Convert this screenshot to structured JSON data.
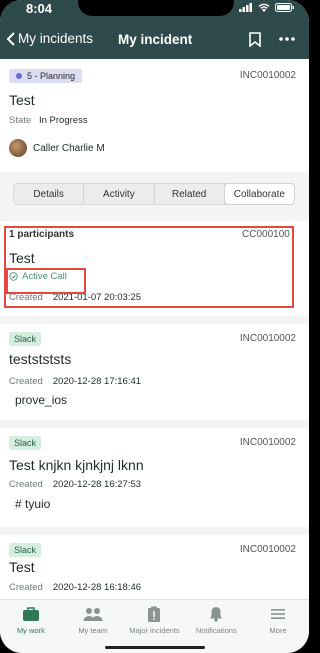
{
  "status": {
    "time": "8:04"
  },
  "nav": {
    "back_label": "My incidents",
    "title": "My incident"
  },
  "header": {
    "state_chip": "5 - Planning",
    "number": "INC0010002",
    "title": "Test",
    "state_label": "State",
    "state_value": "In Progress",
    "caller": "Caller Charlie M"
  },
  "tabs": [
    "Details",
    "Activity",
    "Related",
    "Collaborate"
  ],
  "active_tab": "Collaborate",
  "call_card": {
    "participants": "1 participants",
    "number": "CC000100",
    "title": "Test",
    "status": "Active Call",
    "created_label": "Created",
    "created_value": "2021-01-07 20:03:25"
  },
  "slack_cards": [
    {
      "chip": "Slack",
      "number": "INC0010002",
      "title": "teststststs",
      "created_label": "Created",
      "created_value": "2020-12-28 17:16:41",
      "message": "prove_ios"
    },
    {
      "chip": "Slack",
      "number": "INC0010002",
      "title": "Test knjkn kjnkjnj lknn",
      "created_label": "Created",
      "created_value": "2020-12-28 16:27:53",
      "message": "# tyuio"
    },
    {
      "chip": "Slack",
      "number": "INC0010002",
      "title": "Test",
      "created_label": "Created",
      "created_value": "2020-12-28 16:18:46"
    }
  ],
  "bottom_nav": [
    "My work",
    "My team",
    "Major incidents",
    "Notifications",
    "More"
  ],
  "colors": {
    "nav_bg": "#2f4a4a",
    "accent": "#2f7a55",
    "highlight": "#e8463f"
  }
}
